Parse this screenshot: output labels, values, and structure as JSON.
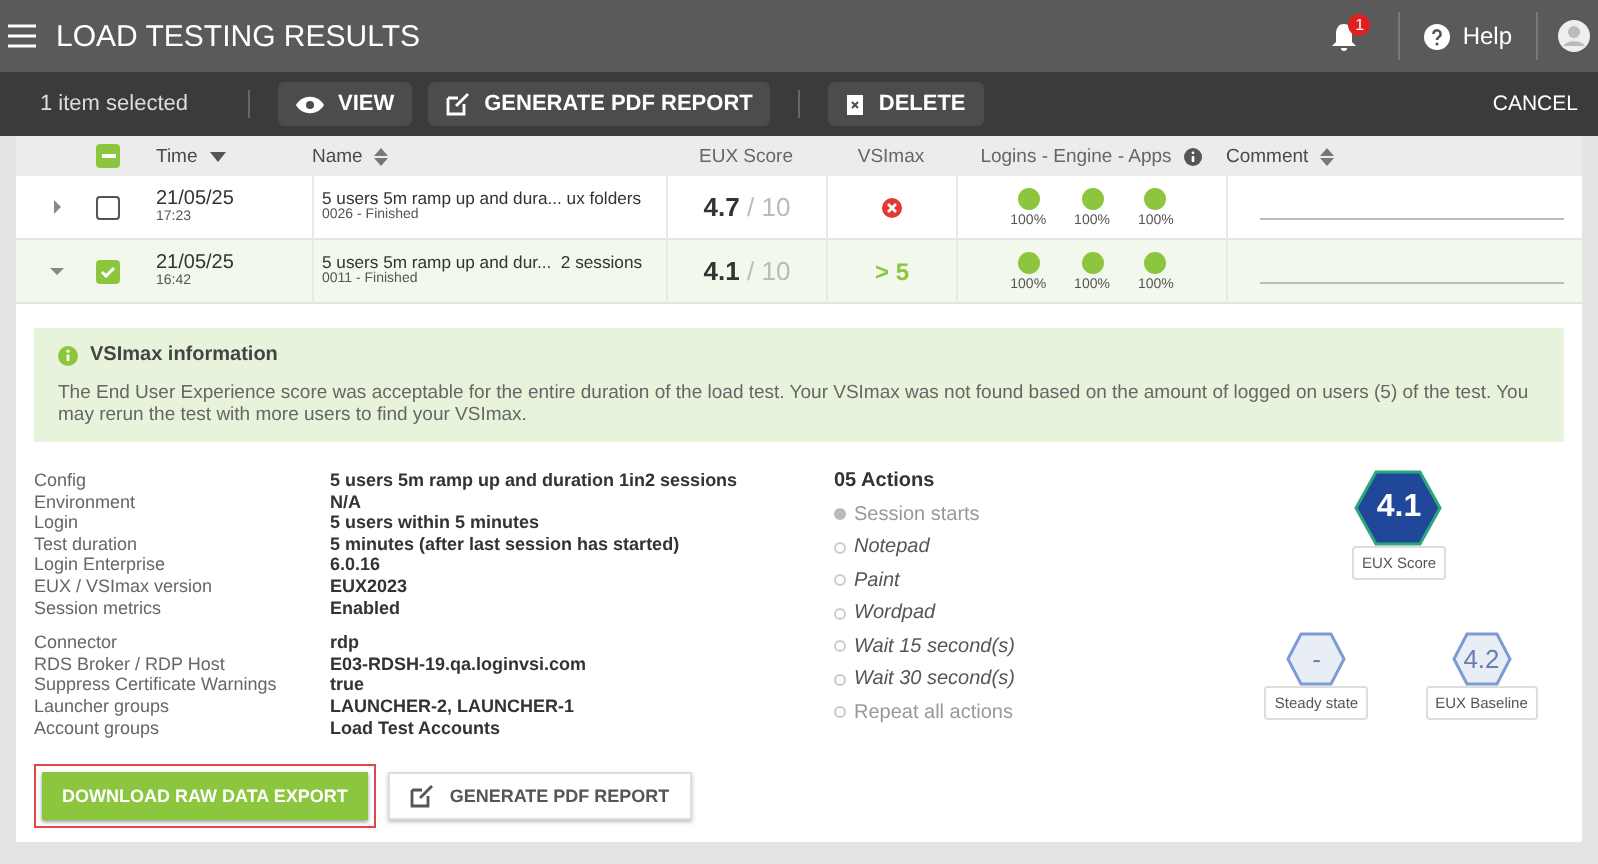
{
  "header": {
    "title": "LOAD TESTING RESULTS",
    "notification_count": "1",
    "help": "Help"
  },
  "toolbar": {
    "selection": "1 item selected",
    "view": "VIEW",
    "generate": "GENERATE PDF REPORT",
    "delete": "DELETE",
    "cancel": "CANCEL"
  },
  "table": {
    "select_all": {
      "indeterminate": true
    },
    "columns": [
      {
        "label": "Time",
        "sortable": true,
        "sorted": true
      },
      {
        "label": "Name",
        "sortable": true,
        "sorted": false
      },
      {
        "label": "EUX Score",
        "sortable": false,
        "sorted": false
      },
      {
        "label": "VSImax",
        "sortable": false,
        "sorted": false
      },
      {
        "label": "Logins - Engine - Apps",
        "sortable": false,
        "sorted": false,
        "info": true
      },
      {
        "label": "Comment",
        "sortable": true,
        "sorted": false
      }
    ],
    "rows": [
      {
        "expanded": false,
        "checked": false,
        "date": "21/05/25",
        "time": "17:23",
        "name": "5 users 5m ramp up and dura... ux folders",
        "sub": "0026 - Finished",
        "score": "4.7",
        "score_max": "/ 10",
        "vsimax": {
          "kind": "fail"
        },
        "dots": [
          {
            "color": "#8cc63f",
            "label": "100%"
          },
          {
            "color": "#8cc63f",
            "label": "100%"
          },
          {
            "color": "#8cc63f",
            "label": "100%"
          }
        ]
      },
      {
        "expanded": true,
        "checked": true,
        "date": "21/05/25",
        "time": "16:42",
        "name": "5 users 5m ramp up and dur...  2 sessions",
        "sub": "0011 - Finished",
        "score": "4.1",
        "score_max": "/ 10",
        "vsimax": {
          "kind": "text",
          "text": "> 5"
        },
        "dots": [
          {
            "color": "#8cc63f",
            "label": "100%"
          },
          {
            "color": "#8cc63f",
            "label": "100%"
          },
          {
            "color": "#8cc63f",
            "label": "100%"
          }
        ]
      }
    ]
  },
  "details": {
    "info": {
      "title": "VSImax information",
      "text": "The End User Experience score was acceptable for the entire duration of the load test. Your VSImax was not found based on the amount of logged on users (5) of the test. You may rerun the test with more users to find your VSImax."
    },
    "groups": [
      [
        {
          "label": "Config",
          "value": "5 users 5m ramp up and duration 1in2 sessions"
        },
        {
          "label": "Environment",
          "value": "N/A"
        },
        {
          "label": "Login",
          "value": "5 users within 5 minutes"
        },
        {
          "label": "Test duration",
          "value": "5 minutes (after last session has started)"
        },
        {
          "label": "Login Enterprise",
          "value": "6.0.16"
        },
        {
          "label": "EUX / VSImax version",
          "value": "EUX2023"
        },
        {
          "label": "Session metrics",
          "value": "Enabled"
        }
      ],
      [
        {
          "label": "Connector",
          "value": "rdp"
        },
        {
          "label": "RDS Broker / RDP Host",
          "value": "E03-RDSH-19.qa.loginvsi.com"
        },
        {
          "label": "Suppress Certificate Warnings",
          "value": "true"
        },
        {
          "label": "Launcher groups",
          "value": "LAUNCHER-2, LAUNCHER-1"
        },
        {
          "label": "Account groups",
          "value": "Load Test Accounts"
        }
      ]
    ],
    "actions_title": "05 Actions",
    "actions": [
      {
        "kind": "start",
        "label": "Session starts"
      },
      {
        "kind": "action",
        "label": "Notepad"
      },
      {
        "kind": "action",
        "label": "Paint"
      },
      {
        "kind": "action",
        "label": "Wordpad"
      },
      {
        "kind": "action",
        "label": "Wait 15 second(s)"
      },
      {
        "kind": "action",
        "label": "Wait 30 second(s)"
      },
      {
        "kind": "repeat",
        "label": "Repeat all actions"
      }
    ],
    "scores": [
      {
        "kind": "main",
        "value": "4.1",
        "label": "EUX Score"
      },
      {
        "kind": "minor",
        "value": "-",
        "label": "Steady state"
      },
      {
        "kind": "minor",
        "value": "4.2",
        "label": "EUX Baseline"
      }
    ],
    "download": "DOWNLOAD RAW DATA EXPORT",
    "generate": "GENERATE PDF REPORT"
  }
}
